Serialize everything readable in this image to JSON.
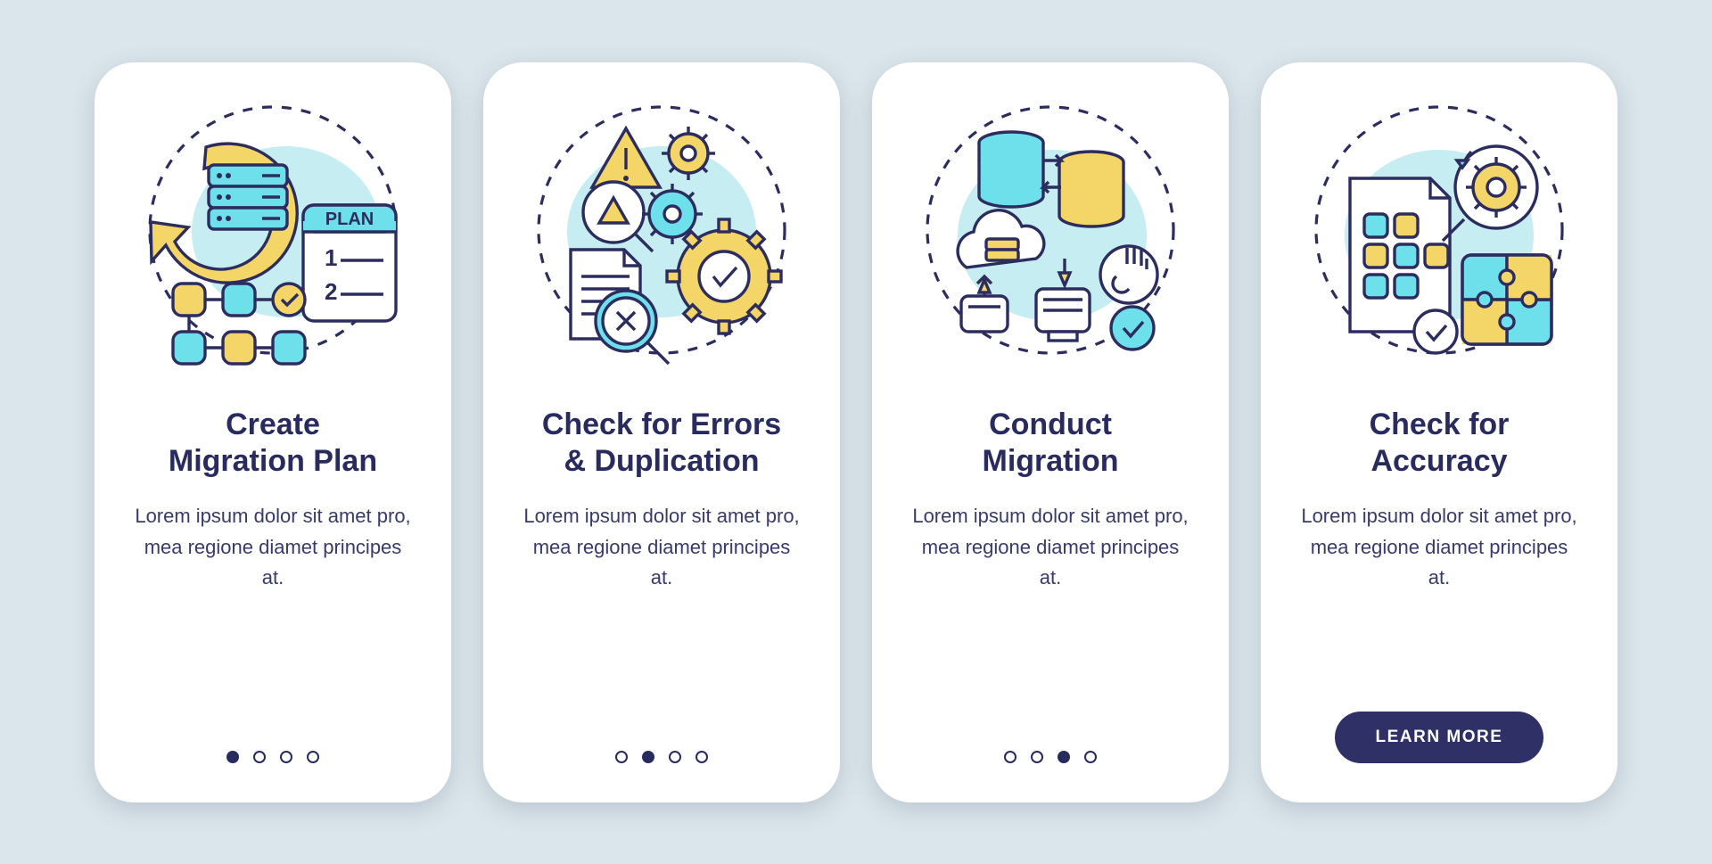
{
  "cards": [
    {
      "title": "Create\nMigration Plan",
      "desc": "Lorem ipsum dolor sit amet pro, mea regione diamet principes at.",
      "activeDot": 0,
      "icon": "create-migration-plan-icon"
    },
    {
      "title": "Check for Errors\n& Duplication",
      "desc": "Lorem ipsum dolor sit amet pro, mea regione diamet principes at.",
      "activeDot": 1,
      "icon": "check-errors-duplication-icon"
    },
    {
      "title": "Conduct\nMigration",
      "desc": "Lorem ipsum dolor sit amet pro, mea regione diamet principes at.",
      "activeDot": 2,
      "icon": "conduct-migration-icon"
    },
    {
      "title": "Check for\nAccuracy",
      "desc": "Lorem ipsum dolor sit amet pro, mea regione diamet principes at.",
      "activeDot": 3,
      "icon": "check-accuracy-icon",
      "cta": "LEARN MORE"
    }
  ],
  "dotCount": 4,
  "planLabel": "PLAN",
  "colors": {
    "navy": "#292a5d",
    "yellow": "#f4d568",
    "cyan": "#6ee0ec",
    "bg": "#dbe6ec"
  }
}
